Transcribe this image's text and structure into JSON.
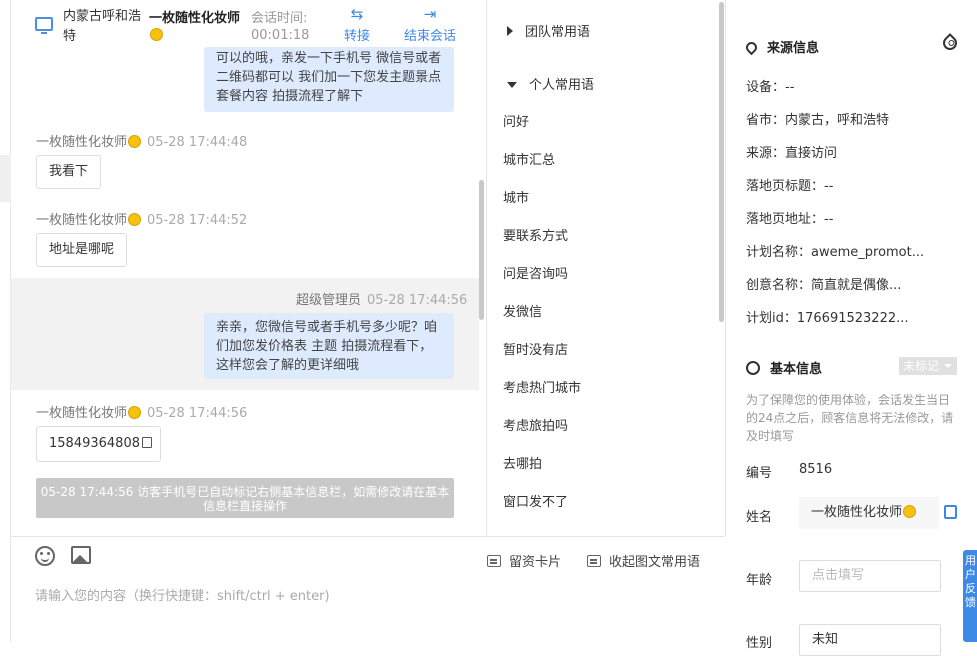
{
  "header": {
    "city": "内蒙古呼和浩特",
    "user": "一枚随性化妆师",
    "time_label": "会话时间:",
    "time_value": "00:01:18",
    "transfer": "转接",
    "end": "结束会话"
  },
  "messages": {
    "top_bubble": "可以的哦，亲发一下手机号 微信号或者二维码都可以 我们加一下您发主题景点套餐内容 拍摄流程了解下",
    "m1": {
      "sender": "一枚随性化妆师",
      "time": "05-28 17:44:48",
      "text": "我看下"
    },
    "m2": {
      "sender": "一枚随性化妆师",
      "time": "05-28 17:44:52",
      "text": "地址是哪呢"
    },
    "m3": {
      "sender": "超级管理员",
      "time": "05-28 17:44:56",
      "text": "亲亲，您微信号或者手机号多少呢？咱们加您发价格表 主题 拍摄流程看下，这样您会了解的更详细哦"
    },
    "m4": {
      "sender": "一枚随性化妆师",
      "time": "05-28 17:44:56",
      "text": "15849364808"
    },
    "system": "05-28 17:44:56 访客手机号已自动标记右侧基本信息栏，如需修改请在基本信息栏直接操作"
  },
  "input": {
    "placeholder": "请输入您的内容（换行快捷键：shift/ctrl + enter)",
    "card_btn": "留资卡片",
    "fold_btn": "收起图文常用语"
  },
  "phrases": {
    "team": "团队常用语",
    "personal": "个人常用语",
    "items": [
      "问好",
      "城市汇总",
      "城市",
      "要联系方式",
      "问是咨询吗",
      "发微信",
      "暂时没有店",
      "考虑热门城市",
      "考虑旅拍吗",
      "去哪拍",
      "窗口发不了"
    ]
  },
  "source": {
    "title": "来源信息",
    "device": "设备：--",
    "province": "省市：内蒙古，呼和浩特",
    "origin": "来源：直接访问",
    "landing_title": "落地页标题：--",
    "landing_url": "落地页地址：--",
    "plan_name": "计划名称：aweme_promot...",
    "creative_name": "创意名称：简直就是偶像...",
    "plan_id": "计划id：176691523222..."
  },
  "basic": {
    "title": "基本信息",
    "tag": "未标记",
    "notice": "为了保障您的使用体验，会话发生当日的24点之后，顾客信息将无法修改，请及时填写",
    "id_label": "编号",
    "id_value": "8516",
    "name_label": "姓名",
    "name_value": "一枚随性化妆师",
    "age_label": "年龄",
    "age_placeholder": "点击填写",
    "gender_label": "性别",
    "gender_value": "未知"
  },
  "float_btn": "用户反馈"
}
